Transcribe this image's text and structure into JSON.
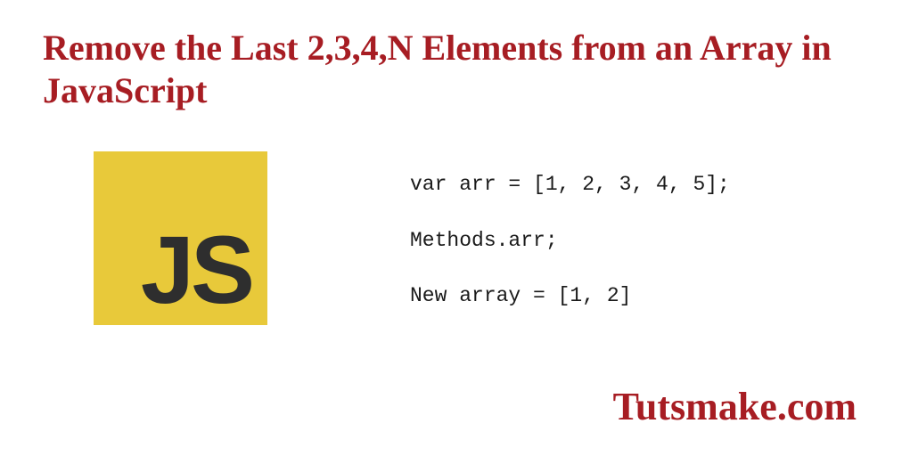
{
  "title": "Remove the Last 2,3,4,N Elements from an Array in JavaScript",
  "logo": {
    "text": "JS"
  },
  "code": {
    "line1": "var arr = [1, 2, 3, 4, 5];",
    "line2": "Methods.arr;",
    "line3": "New array = [1, 2]"
  },
  "brand": "Tutsmake.com"
}
